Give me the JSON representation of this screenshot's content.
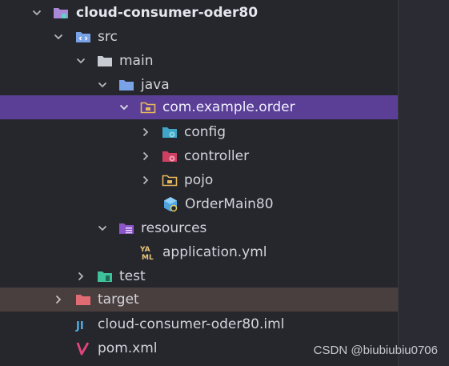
{
  "tree": {
    "project_name": "cloud-consumer-oder80",
    "src": "src",
    "main": "main",
    "java": "java",
    "package": "com.example.order",
    "config": "config",
    "controller": "controller",
    "pojo": "pojo",
    "main_class": "OrderMain80",
    "resources": "resources",
    "application_yml": "application.yml",
    "test": "test",
    "target": "target",
    "iml_file": "cloud-consumer-oder80.iml",
    "pom": "pom.xml"
  },
  "watermark": "CSDN @biubiubiu0706",
  "colors": {
    "selected_row": "#5b3f96",
    "excluded_row": "#4a3f3f",
    "text": "#d3d5dc"
  }
}
